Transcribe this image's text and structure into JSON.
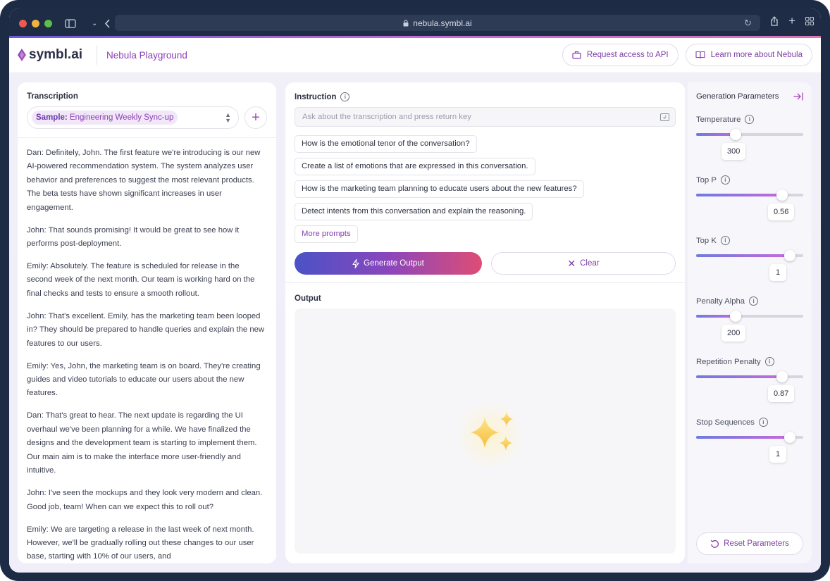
{
  "browser": {
    "url": "nebula.symbl.ai"
  },
  "header": {
    "logo_text": "symbl.ai",
    "app_title": "Nebula Playground",
    "request_access_label": "Request access to API",
    "learn_more_label": "Learn more about Nebula"
  },
  "transcription": {
    "title": "Transcription",
    "sample_prefix": "Sample:",
    "sample_name": "Engineering Weekly Sync-up",
    "paragraphs": [
      "Dan: Definitely, John. The first feature we're introducing is our new AI-powered recommendation system. The system analyzes user behavior and preferences to suggest the most relevant products. The beta tests have shown significant increases in user engagement.",
      "John: That sounds promising! It would be great to see how it performs post-deployment.",
      "Emily: Absolutely. The feature is scheduled for release in the second week of the next month. Our team is working hard on the final checks and tests to ensure a smooth rollout.",
      "John: That's excellent. Emily, has the marketing team been looped in? They should be prepared to handle queries and explain the new features to our users.",
      "Emily: Yes, John, the marketing team is on board. They're creating guides and video tutorials to educate our users about the new features.",
      "Dan: That's great to hear. The next update is regarding the UI overhaul we've been planning for a while. We have finalized the designs and the development team is starting to implement them. Our main aim is to make the interface more user-friendly and intuitive.",
      "John: I've seen the mockups and they look very modern and clean. Good job, team! When can we expect this to roll out?",
      "Emily: We are targeting a release in the last week of next month. However, we'll be gradually rolling out these changes to our user base, starting with 10% of our users, and"
    ]
  },
  "instruction": {
    "title": "Instruction",
    "placeholder": "Ask about the transcription and press return key",
    "prompts": [
      "How is the emotional tenor of the conversation?",
      "Create a list of emotions that are expressed in this conversation.",
      "How is the marketing team planning to educate users about the new features?",
      "Detect intents from this conversation and explain the reasoning."
    ],
    "more_prompts_label": "More prompts",
    "generate_label": "Generate Output",
    "clear_label": "Clear"
  },
  "output": {
    "title": "Output"
  },
  "parameters": {
    "title": "Generation Parameters",
    "items": [
      {
        "label": "Temperature",
        "value": "300",
        "fraction": 0.35
      },
      {
        "label": "Top P",
        "value": "0.56",
        "fraction": 0.84
      },
      {
        "label": "Top K",
        "value": "1",
        "fraction": 0.92
      },
      {
        "label": "Penalty Alpha",
        "value": "200",
        "fraction": 0.35
      },
      {
        "label": "Repetition Penalty",
        "value": "0.87",
        "fraction": 0.84
      },
      {
        "label": "Stop Sequences",
        "value": "1",
        "fraction": 0.92
      }
    ],
    "reset_label": "Reset Parameters"
  }
}
